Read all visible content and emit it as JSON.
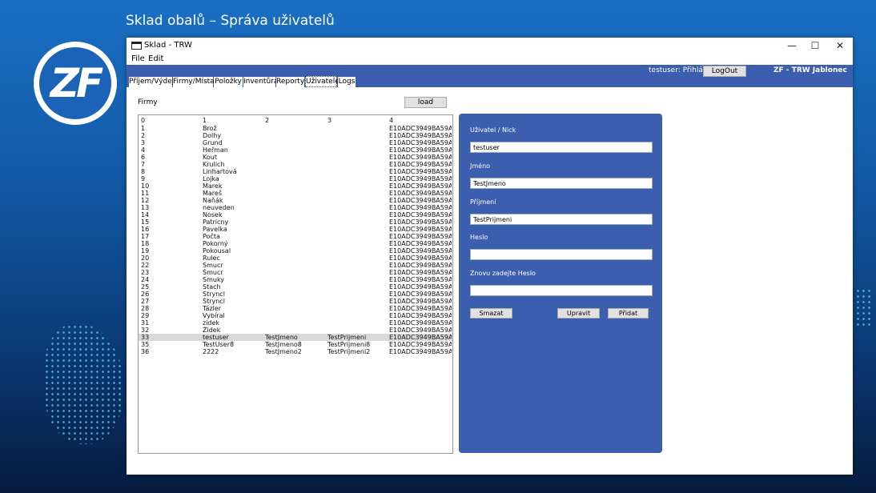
{
  "slide": {
    "title": "Sklad obalů – Správa uživatelů",
    "logo_text": "ZF"
  },
  "window": {
    "title": "Sklad - TRW",
    "min": "—",
    "max": "☐",
    "close": "✕"
  },
  "menu": [
    "File",
    "Edit"
  ],
  "header": {
    "status": "testuser: Přihlášen",
    "logout": "LogOut",
    "brand": "ZF - TRW Jablonec"
  },
  "tabs": [
    "Příjem/Výdej",
    "Firmy/Místa",
    "Položky",
    "Inventůra",
    "Reporty",
    "Uživatele",
    "Logs"
  ],
  "active_tab": "Uživatele",
  "firmy_label": "Firmy",
  "load_label": "load",
  "grid": {
    "columns": [
      "0",
      "1",
      "2",
      "3",
      "4"
    ],
    "rows": [
      [
        "1",
        "Brož",
        "",
        "",
        "E10ADC3949BA59A..."
      ],
      [
        "2",
        "Dolhy",
        "",
        "",
        "E10ADC3949BA59A..."
      ],
      [
        "3",
        "Grund",
        "",
        "",
        "E10ADC3949BA59A..."
      ],
      [
        "4",
        "Heřman",
        "",
        "",
        "E10ADC3949BA59A..."
      ],
      [
        "6",
        "Kout",
        "",
        "",
        "E10ADC3949BA59A..."
      ],
      [
        "7",
        "Krulich",
        "",
        "",
        "E10ADC3949BA59A..."
      ],
      [
        "8",
        "Linhartová",
        "",
        "",
        "E10ADC3949BA59A..."
      ],
      [
        "9",
        "Lojka",
        "",
        "",
        "E10ADC3949BA59A..."
      ],
      [
        "10",
        "Marek",
        "",
        "",
        "E10ADC3949BA59A..."
      ],
      [
        "11",
        "Mareš",
        "",
        "",
        "E10ADC3949BA59A..."
      ],
      [
        "12",
        "Naňák",
        "",
        "",
        "E10ADC3949BA59A..."
      ],
      [
        "13",
        "neuveden",
        "",
        "",
        "E10ADC3949BA59A..."
      ],
      [
        "14",
        "Nosek",
        "",
        "",
        "E10ADC3949BA59A..."
      ],
      [
        "15",
        "Patricny",
        "",
        "",
        "E10ADC3949BA59A..."
      ],
      [
        "16",
        "Pavelka",
        "",
        "",
        "E10ADC3949BA59A..."
      ],
      [
        "17",
        "Počta",
        "",
        "",
        "E10ADC3949BA59A..."
      ],
      [
        "18",
        "Pokorný",
        "",
        "",
        "E10ADC3949BA59A..."
      ],
      [
        "19",
        "Pokousal",
        "",
        "",
        "E10ADC3949BA59A..."
      ],
      [
        "20",
        "Rulec",
        "",
        "",
        "E10ADC3949BA59A..."
      ],
      [
        "22",
        "Smucr",
        "",
        "",
        "E10ADC3949BA59A..."
      ],
      [
        "23",
        "Šmucr",
        "",
        "",
        "E10ADC3949BA59A..."
      ],
      [
        "24",
        "Smuky",
        "",
        "",
        "E10ADC3949BA59A..."
      ],
      [
        "25",
        "Stach",
        "",
        "",
        "E10ADC3949BA59A..."
      ],
      [
        "26",
        "Stryncl",
        "",
        "",
        "E10ADC3949BA59A..."
      ],
      [
        "27",
        "Štryncl",
        "",
        "",
        "E10ADC3949BA59A..."
      ],
      [
        "28",
        "Tázler",
        "",
        "",
        "E10ADC3949BA59A..."
      ],
      [
        "29",
        "Vybíral",
        "",
        "",
        "E10ADC3949BA59A..."
      ],
      [
        "31",
        "zidek",
        "",
        "",
        "E10ADC3949BA59A..."
      ],
      [
        "32",
        "Židek",
        "",
        "",
        "E10ADC3949BA59A..."
      ],
      [
        "33",
        "testuser",
        "TestJmeno",
        "TestPrijmeni",
        "E10ADC3949BA59A..."
      ],
      [
        "35",
        "TestUser8",
        "TestJmeno8",
        "TestPrijmeni8",
        "E10ADC3949BA59A..."
      ],
      [
        "36",
        "2222",
        "TestJmeno2",
        "TestPrijmeni2",
        "E10ADC3949BA59A..."
      ]
    ],
    "selected_row": 29
  },
  "form": {
    "nick_label": "Uživatel / Nick",
    "nick_value": "testuser",
    "jmeno_label": "Jméno",
    "jmeno_value": "TestJmeno",
    "prijmeni_label": "Příjmení",
    "prijmeni_value": "TestPrijmeni",
    "heslo_label": "Heslo",
    "heslo_value": "",
    "heslo2_label": "Znovu zadejte Heslo",
    "heslo2_value": "",
    "btn_delete": "Smazat",
    "btn_edit": "Upravit",
    "btn_add": "Přidat"
  },
  "colors": {
    "accent": "#3c5eae",
    "slide_bg": "#1a6fc4",
    "selection": "#d9d9d9"
  }
}
